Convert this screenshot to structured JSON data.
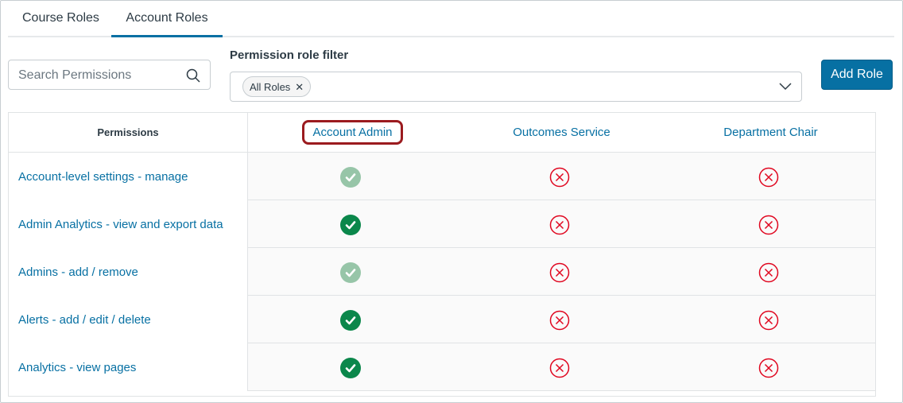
{
  "tabs": [
    {
      "label": "Course Roles",
      "active": false
    },
    {
      "label": "Account Roles",
      "active": true
    }
  ],
  "search": {
    "placeholder": "Search Permissions"
  },
  "filter": {
    "label": "Permission role filter",
    "chip": "All Roles"
  },
  "add_role": "Add Role",
  "table": {
    "header": "Permissions",
    "roles": [
      "Account Admin",
      "Outcomes Service",
      "Department Chair"
    ],
    "rows": [
      {
        "name": "Account-level settings - manage",
        "states": [
          "enabled-locked",
          "disabled",
          "disabled"
        ]
      },
      {
        "name": "Admin Analytics - view and export data",
        "states": [
          "enabled",
          "disabled",
          "disabled"
        ]
      },
      {
        "name": "Admins - add / remove",
        "states": [
          "enabled-locked",
          "disabled",
          "disabled"
        ]
      },
      {
        "name": "Alerts - add / edit / delete",
        "states": [
          "enabled",
          "disabled",
          "disabled"
        ]
      },
      {
        "name": "Analytics - view pages",
        "states": [
          "enabled",
          "disabled",
          "disabled"
        ]
      }
    ]
  },
  "colors": {
    "accent": "#0770a3",
    "enabled": "#0b874b",
    "enabled_locked": "#97c5a8",
    "disabled": "#e0061f",
    "highlight": "#9b1b1f"
  }
}
